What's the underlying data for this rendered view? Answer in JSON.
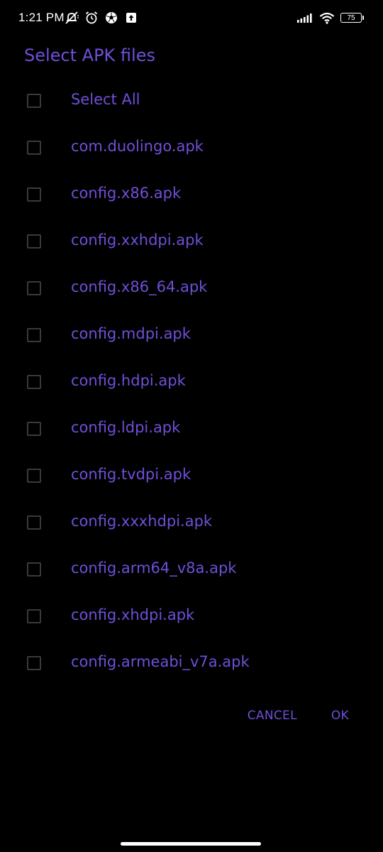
{
  "status_bar": {
    "time": "1:21 PM",
    "battery": "75",
    "left_icons": [
      "mute-vibrate-icon",
      "alarm-icon",
      "soccer-ball-icon",
      "upload-icon"
    ],
    "right_icons": [
      "signal-icon",
      "wifi-icon",
      "battery-icon"
    ]
  },
  "dialog": {
    "title": "Select APK files",
    "items": [
      {
        "label": "Select All",
        "checked": false
      },
      {
        "label": "com.duolingo.apk",
        "checked": false
      },
      {
        "label": "config.x86.apk",
        "checked": false
      },
      {
        "label": "config.xxhdpi.apk",
        "checked": false
      },
      {
        "label": "config.x86_64.apk",
        "checked": false
      },
      {
        "label": "config.mdpi.apk",
        "checked": false
      },
      {
        "label": "config.hdpi.apk",
        "checked": false
      },
      {
        "label": "config.ldpi.apk",
        "checked": false
      },
      {
        "label": "config.tvdpi.apk",
        "checked": false
      },
      {
        "label": "config.xxxhdpi.apk",
        "checked": false
      },
      {
        "label": "config.arm64_v8a.apk",
        "checked": false
      },
      {
        "label": "config.xhdpi.apk",
        "checked": false
      },
      {
        "label": "config.armeabi_v7a.apk",
        "checked": false
      }
    ],
    "cancel_label": "CANCEL",
    "ok_label": "OK"
  },
  "colors": {
    "accent": "#6f4fd8",
    "background": "#000000",
    "checkbox_border": "#3a3a3a"
  }
}
